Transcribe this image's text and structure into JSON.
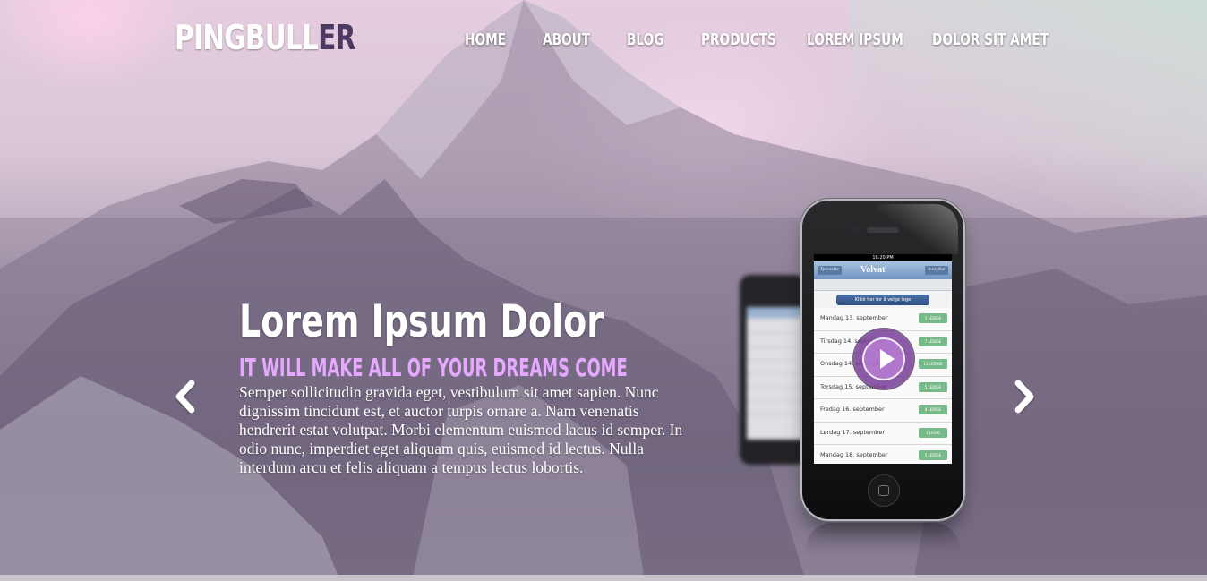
{
  "header": {
    "logo_main": "PINGBULL",
    "logo_accent": "ER",
    "nav": [
      {
        "label": "HOME"
      },
      {
        "label": "ABOUT"
      },
      {
        "label": "BLOG"
      },
      {
        "label": "PRODUCTS"
      },
      {
        "label": "LOREM IPSUM"
      },
      {
        "label": "DOLOR SIT AMET"
      }
    ]
  },
  "slide": {
    "title": "Lorem Ipsum Dolor",
    "subtitle": "IT WILL MAKE ALL OF YOUR DREAMS COME",
    "body": "Semper sollicitudin gravida eget, vestibulum sit amet sapien. Nunc dignissim tincidunt est, et auctor turpis ornare a. Nam venenatis hendrerit estat volutpat. Morbi elementum euismod lacus id semper. In odio nunc, imperdiet eget aliquam quis, euismod id lectus. Nulla interdum arcu et felis aliquam a tempus lectus lobortis."
  },
  "controls": {
    "prev_icon": "chevron-left-icon",
    "next_icon": "chevron-right-icon",
    "play_icon": "play-icon"
  },
  "phone_screen": {
    "time": "16:20 PM",
    "back_label": "Tjenester",
    "brand": "Volvat",
    "right_label": "Innstiller",
    "button_label": "Klikk her for å velge lege",
    "rows": [
      {
        "day": "Mandag 13. september",
        "tag": "5 LEDIGE"
      },
      {
        "day": "Tirsdag 14. september",
        "tag": "7 LEDIGE"
      },
      {
        "day": "Onsdag 14. september",
        "tag": "13 LEDIGE"
      },
      {
        "day": "Torsdag 15. september",
        "tag": "5 LEDIGE"
      },
      {
        "day": "Fredag 16. september",
        "tag": "8 LEDIGE"
      },
      {
        "day": "Lørdag 17. september",
        "tag": "1 LEDIG"
      },
      {
        "day": "Mandag 18. september",
        "tag": "5 LEDIGE"
      }
    ]
  },
  "colors": {
    "logo_accent": "#4d3a63",
    "subtitle": "#e6a9ff",
    "nav_text": "#ffffff"
  }
}
